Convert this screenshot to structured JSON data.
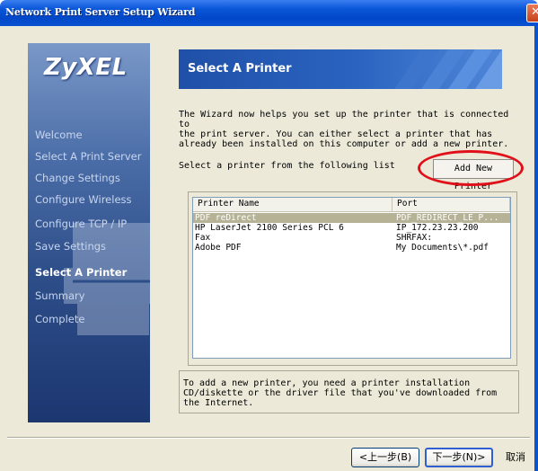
{
  "window": {
    "title": "Network Print Server Setup Wizard",
    "close_glyph": "✕"
  },
  "sidebar": {
    "logo": "ZyXEL",
    "items": [
      {
        "label": "Welcome",
        "active": false
      },
      {
        "label": "Select A Print Server",
        "active": false
      },
      {
        "label": "Change Settings",
        "active": false
      },
      {
        "label": "Configure Wireless",
        "active": false
      },
      {
        "label": "Configure  TCP / IP",
        "active": false
      },
      {
        "label": "Save Settings",
        "active": false
      },
      {
        "label": "Select A Printer",
        "active": true
      },
      {
        "label": "Summary",
        "active": false
      },
      {
        "label": "Complete",
        "active": false
      }
    ]
  },
  "page": {
    "title": "Select A Printer",
    "intro_lines": [
      "The Wizard now helps you set up the printer that is connected to",
      "the print server. You can either select a printer that has",
      "already been installed on this computer or add a new printer."
    ],
    "select_label": "Select a printer from the following list",
    "add_new_printer": "Add New Printer",
    "table": {
      "columns": [
        "Printer Name",
        "Port"
      ],
      "rows": [
        {
          "name": "PDF reDirect",
          "port": "PDF_REDIRECT_LE_P...",
          "selected": true
        },
        {
          "name": "HP LaserJet 2100 Series PCL 6",
          "port": "IP_172.23.23.200",
          "selected": false
        },
        {
          "name": "Fax",
          "port": "SHRFAX:",
          "selected": false
        },
        {
          "name": "Adobe PDF",
          "port": "My Documents\\*.pdf",
          "selected": false
        }
      ]
    },
    "hint_lines": [
      "To add a new printer, you need a printer installation",
      "CD/diskette or the driver file that you've downloaded from",
      "the Internet."
    ]
  },
  "footer": {
    "back_label": "<上一步(B)",
    "next_label": "下一步(N)>",
    "cancel_label": "取消"
  },
  "colors": {
    "title_bar": "#0a56d8",
    "dialog_bg": "#ece9d8",
    "highlight_oval": "#e0101a",
    "selected_row": "#b5b296"
  }
}
